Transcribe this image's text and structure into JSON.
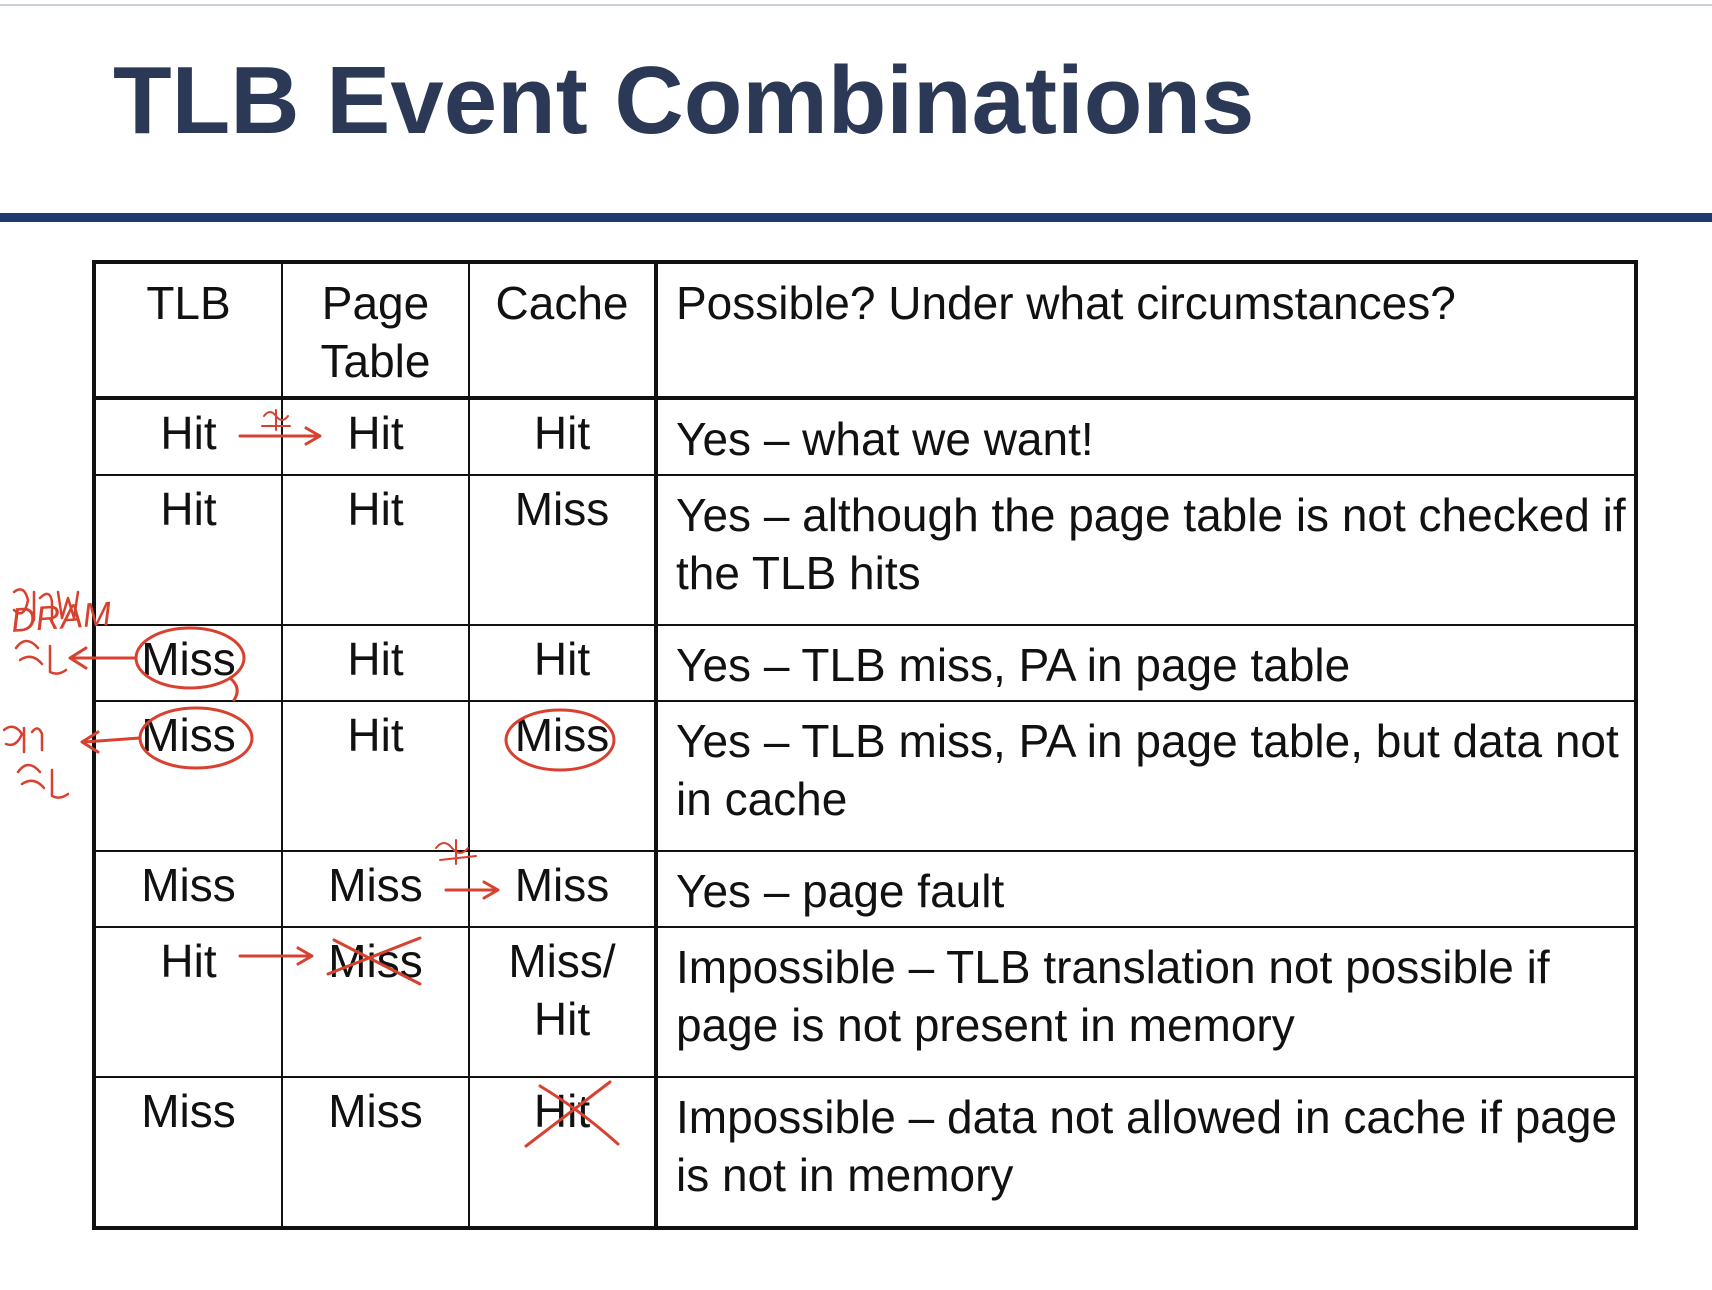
{
  "title": "TLB Event Combinations",
  "table": {
    "headers": [
      "TLB",
      "Page Table",
      "Cache",
      "Possible?  Under what circumstances?"
    ],
    "rows": [
      {
        "tlb": "Hit",
        "page_table": "Hit",
        "cache": "Hit",
        "description": "Yes – what we want!"
      },
      {
        "tlb": "Hit",
        "page_table": "Hit",
        "cache": "Miss",
        "description": "Yes – although the page table is not checked if the TLB hits"
      },
      {
        "tlb": "Miss",
        "page_table": "Hit",
        "cache": "Hit",
        "description": "Yes – TLB miss, PA in page table"
      },
      {
        "tlb": "Miss",
        "page_table": "Hit",
        "cache": "Miss",
        "description": "Yes – TLB miss, PA in page table, but data not in cache"
      },
      {
        "tlb": "Miss",
        "page_table": "Miss",
        "cache": "Miss",
        "description": "Yes – page fault"
      },
      {
        "tlb": "Hit",
        "page_table": "Miss",
        "cache": "Miss/ Hit",
        "description": "Impossible – TLB translation not possible if page is not present in memory"
      },
      {
        "tlb": "Miss",
        "page_table": "Miss",
        "cache": "Hit",
        "description": "Impossible – data not allowed in cache if page is not in memory"
      }
    ]
  },
  "annotations": {
    "dram_label": "DRAM",
    "ink_color": "#d8412f"
  }
}
